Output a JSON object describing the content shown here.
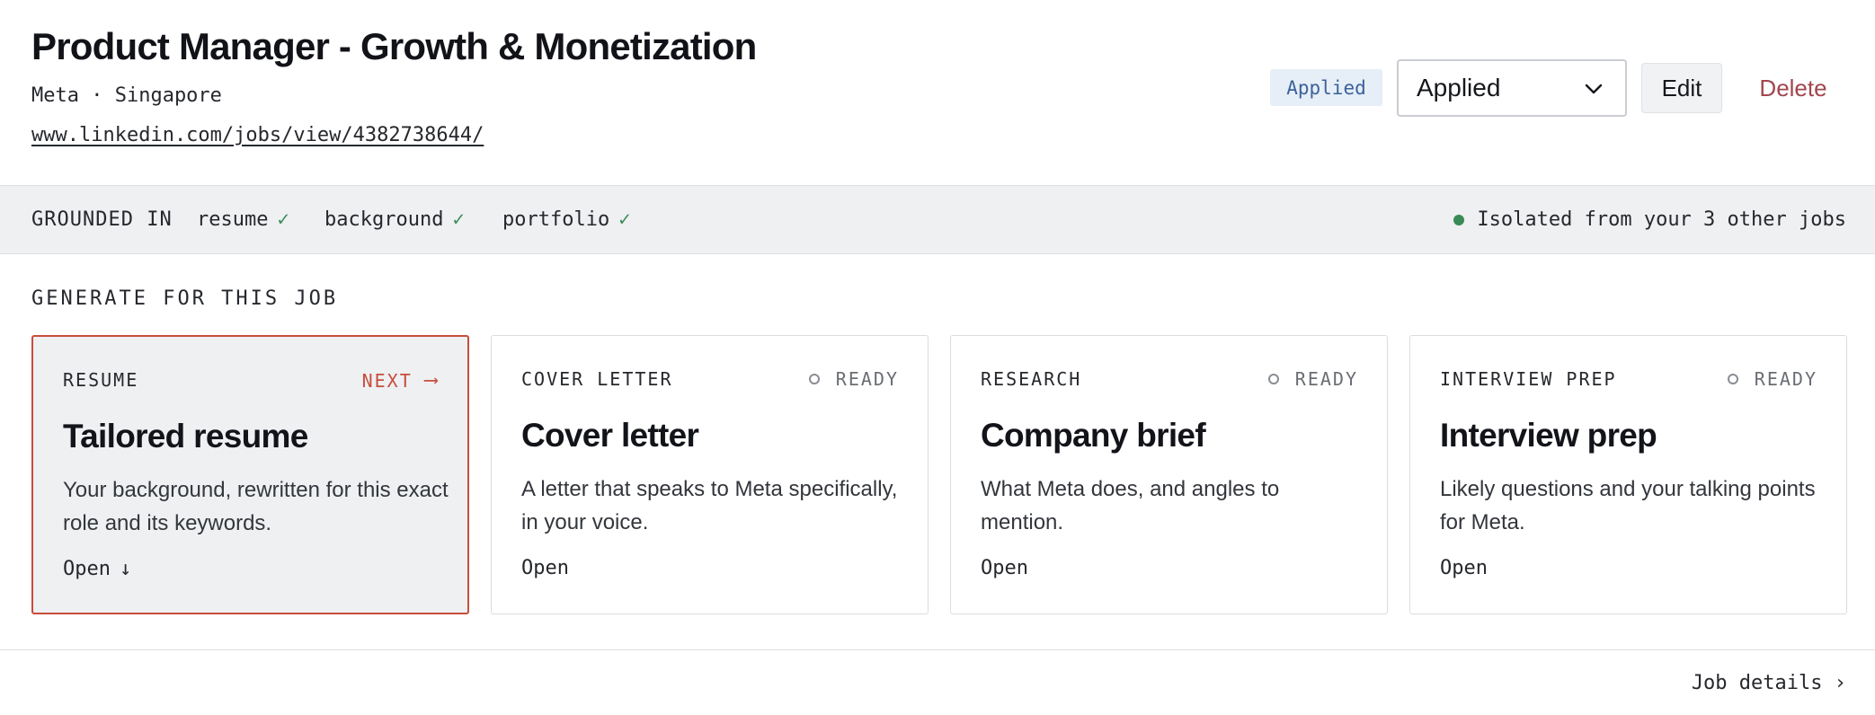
{
  "job": {
    "title": "Product Manager - Growth & Monetization",
    "subtitle": "Meta · Singapore",
    "link": "www.linkedin.com/jobs/view/4382738644/"
  },
  "actions": {
    "status_badge": "Applied",
    "status_select": "Applied",
    "edit_label": "Edit",
    "delete_label": "Delete"
  },
  "grounded": {
    "label": "GROUNDED IN",
    "sources": [
      {
        "name": "resume",
        "check": "✓"
      },
      {
        "name": "background",
        "check": "✓"
      },
      {
        "name": "portfolio",
        "check": "✓"
      }
    ],
    "isolation": "Isolated from your 3 other jobs"
  },
  "generate": {
    "label": "GENERATE FOR THIS JOB",
    "cards": [
      {
        "kind": "RESUME",
        "state": "NEXT",
        "state_arrow": "⟶",
        "title": "Tailored resume",
        "desc": "Your background, rewritten for this exact role and its keywords.",
        "open": "Open",
        "open_arrow": "↓"
      },
      {
        "kind": "COVER LETTER",
        "state": "READY",
        "title": "Cover letter",
        "desc": "A letter that speaks to Meta specifically, in your voice.",
        "open": "Open"
      },
      {
        "kind": "RESEARCH",
        "state": "READY",
        "title": "Company brief",
        "desc": "What Meta does, and angles to mention.",
        "open": "Open"
      },
      {
        "kind": "INTERVIEW PREP",
        "state": "READY",
        "title": "Interview prep",
        "desc": "Likely questions and your talking points for Meta.",
        "open": "Open"
      }
    ]
  },
  "footer": {
    "job_details": "Job details ›"
  },
  "colors": {
    "accent_red": "#c84d3c",
    "delete_red": "#a2464e",
    "badge_blue": "#3a629a",
    "check_green": "#3d8a5a"
  }
}
